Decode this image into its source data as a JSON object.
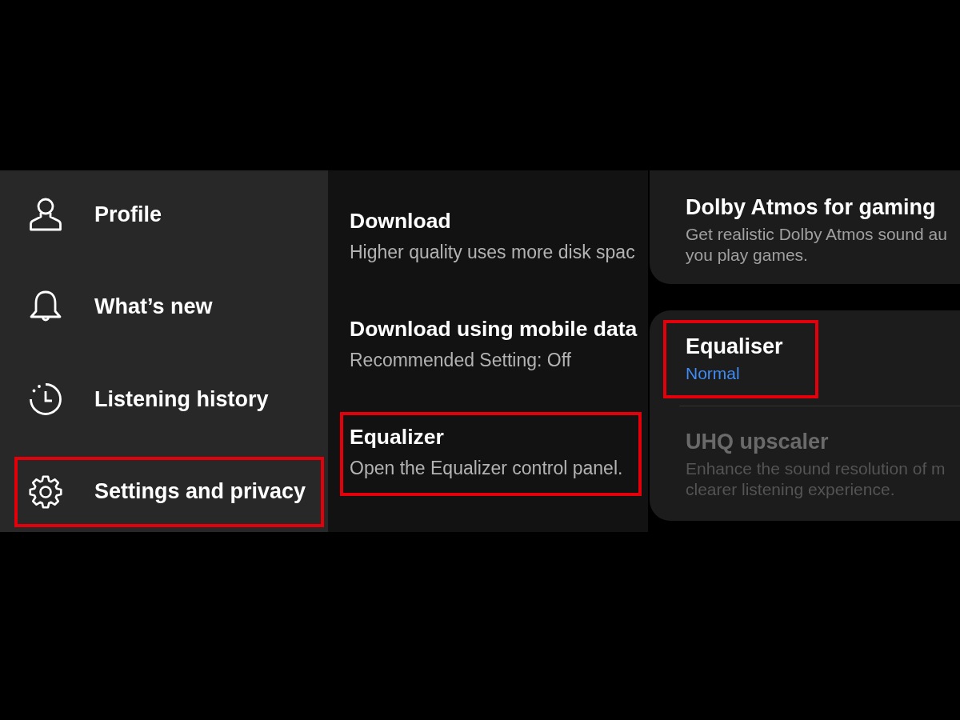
{
  "menu": {
    "items": [
      {
        "label": "Profile",
        "highlighted": false
      },
      {
        "label": "What’s new",
        "highlighted": false
      },
      {
        "label": "Listening history",
        "highlighted": false
      },
      {
        "label": "Settings and privacy",
        "highlighted": true
      }
    ]
  },
  "app_settings": {
    "items": [
      {
        "title": "Download",
        "subtitle": "Higher quality uses more disk spac",
        "highlighted": false
      },
      {
        "title": "Download using mobile data",
        "subtitle": "Recommended Setting: Off",
        "highlighted": false
      },
      {
        "title": "Equalizer",
        "subtitle": "Open the Equalizer control panel.",
        "highlighted": true
      }
    ]
  },
  "sound_settings": {
    "cards": [
      {
        "items": [
          {
            "title": "Dolby Atmos for gaming",
            "description": [
              "Get realistic Dolby Atmos sound au",
              "you play games."
            ],
            "highlighted": false,
            "disabled": false
          }
        ]
      },
      {
        "items": [
          {
            "title": "Equaliser",
            "value": "Normal",
            "highlighted": true,
            "disabled": false
          },
          {
            "title": "UHQ upscaler",
            "description": [
              "Enhance the sound resolution of m",
              "clearer listening experience."
            ],
            "highlighted": false,
            "disabled": true
          }
        ]
      }
    ]
  }
}
